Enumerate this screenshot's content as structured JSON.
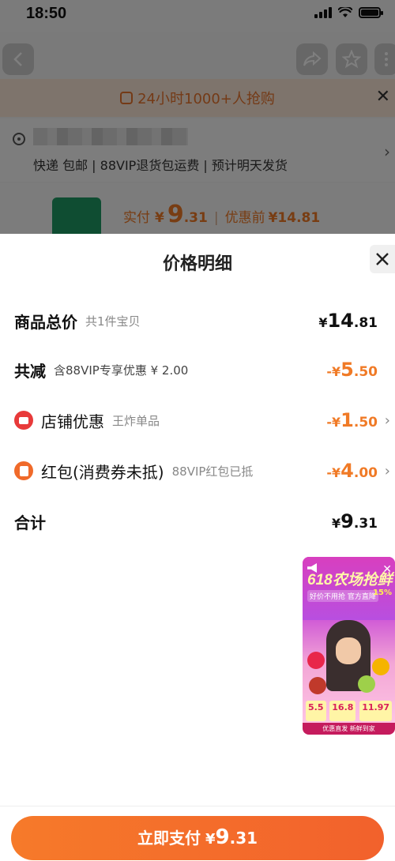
{
  "status_bar": {
    "time": "18:50"
  },
  "background": {
    "promo_text": "24小时1000+人抢购",
    "shipping_text": "快递 包邮 | 88VIP退货包运费 | 预计明天发货",
    "price_label": "实付",
    "price_yen": "¥",
    "price_int": "9",
    "price_dec": ".31",
    "before_label": "优惠前",
    "before_value": "¥14.81"
  },
  "sheet": {
    "title": "价格明细",
    "close_icon": "close-icon",
    "rows": [
      {
        "label": "商品总价",
        "sub": "共1件宝贝",
        "yen": "¥",
        "int": "14",
        "dec": ".81"
      },
      {
        "label": "共减",
        "sub": "含88VIP专享优惠 ¥ 2.00",
        "yen": "-¥",
        "int": "5",
        "dec": ".50"
      },
      {
        "label": "店铺优惠",
        "sub": "王炸单品",
        "yen": "-¥",
        "int": "1",
        "dec": ".50"
      },
      {
        "label": "红包(消费券未抵)",
        "sub": "88VIP红包已抵",
        "yen": "-¥",
        "int": "4",
        "dec": ".00"
      },
      {
        "label": "合计",
        "yen": "¥",
        "int": "9",
        "dec": ".31"
      }
    ]
  },
  "video_ad": {
    "title": "618农场抢鲜",
    "subtitle": "好价不用抢",
    "official": "官方直降",
    "percent": "15%",
    "prices": [
      "5.5",
      "16.8",
      "11.97"
    ],
    "footer": "优惠直发 新鲜到家"
  },
  "pay_button": {
    "label": "立即支付",
    "yen": "¥",
    "int": "9",
    "dec": ".31"
  },
  "colors": {
    "accent": "#f07a26",
    "shop_icon": "#e83a3a",
    "redpack_icon": "#f06a2a"
  }
}
